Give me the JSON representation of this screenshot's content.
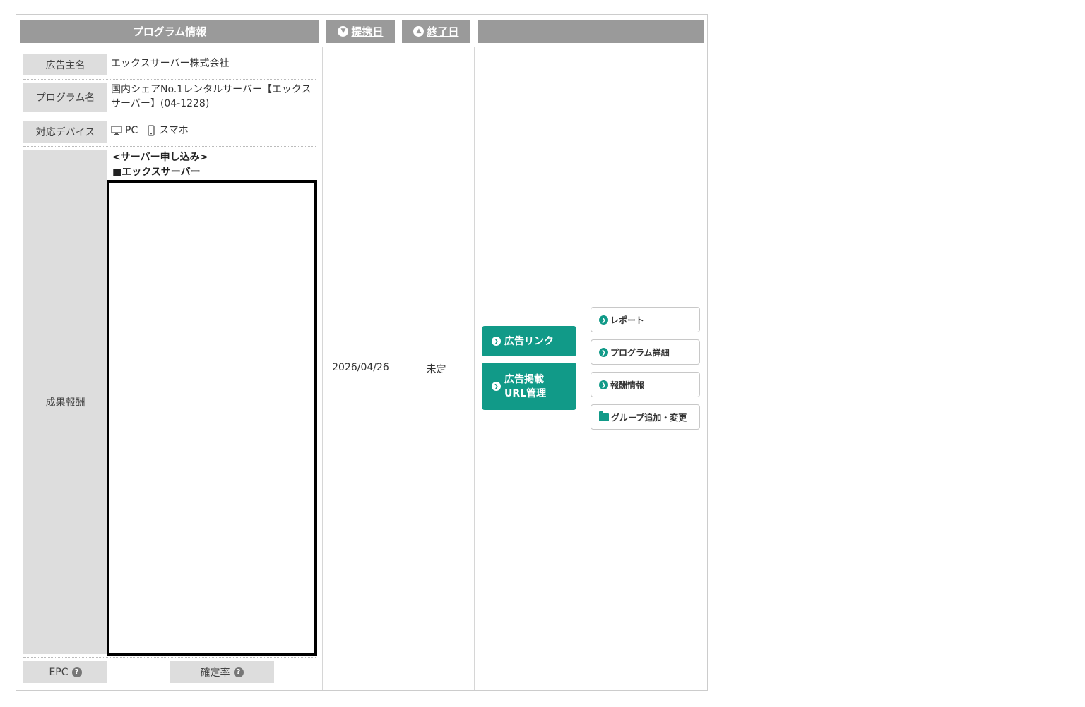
{
  "header": {
    "program_info": "プログラム情報",
    "start_date": "提携日",
    "end_date": "終了日",
    "actions": ""
  },
  "program": {
    "advertiser_label": "広告主名",
    "advertiser": "エックスサーバー株式会社",
    "program_label": "プログラム名",
    "program_name": "国内シェアNo.1レンタルサーバー【エックスサーバー】(04-1228)",
    "device_label": "対応デバイス",
    "device_pc": "PC",
    "device_sp": "スマホ",
    "reward_label": "成果報酬",
    "reward_title_1": "<サーバー申し込み>",
    "reward_title_2": "■エックスサーバー",
    "epc_label": "EPC",
    "epc_value": "",
    "confirm_label": "確定率",
    "confirm_value": "—"
  },
  "dates": {
    "start": "2026/04/26",
    "end": "未定"
  },
  "actions": {
    "ad_link": "広告リンク",
    "url_mgmt_1": "広告掲載",
    "url_mgmt_2": "URL管理",
    "report": "レポート",
    "program_detail": "プログラム詳細",
    "reward_info": "報酬情報",
    "group": "グループ追加・変更"
  },
  "colors": {
    "header_bg": "#9a9a9a",
    "label_bg": "#dddddd",
    "accent_green": "#119a88"
  }
}
